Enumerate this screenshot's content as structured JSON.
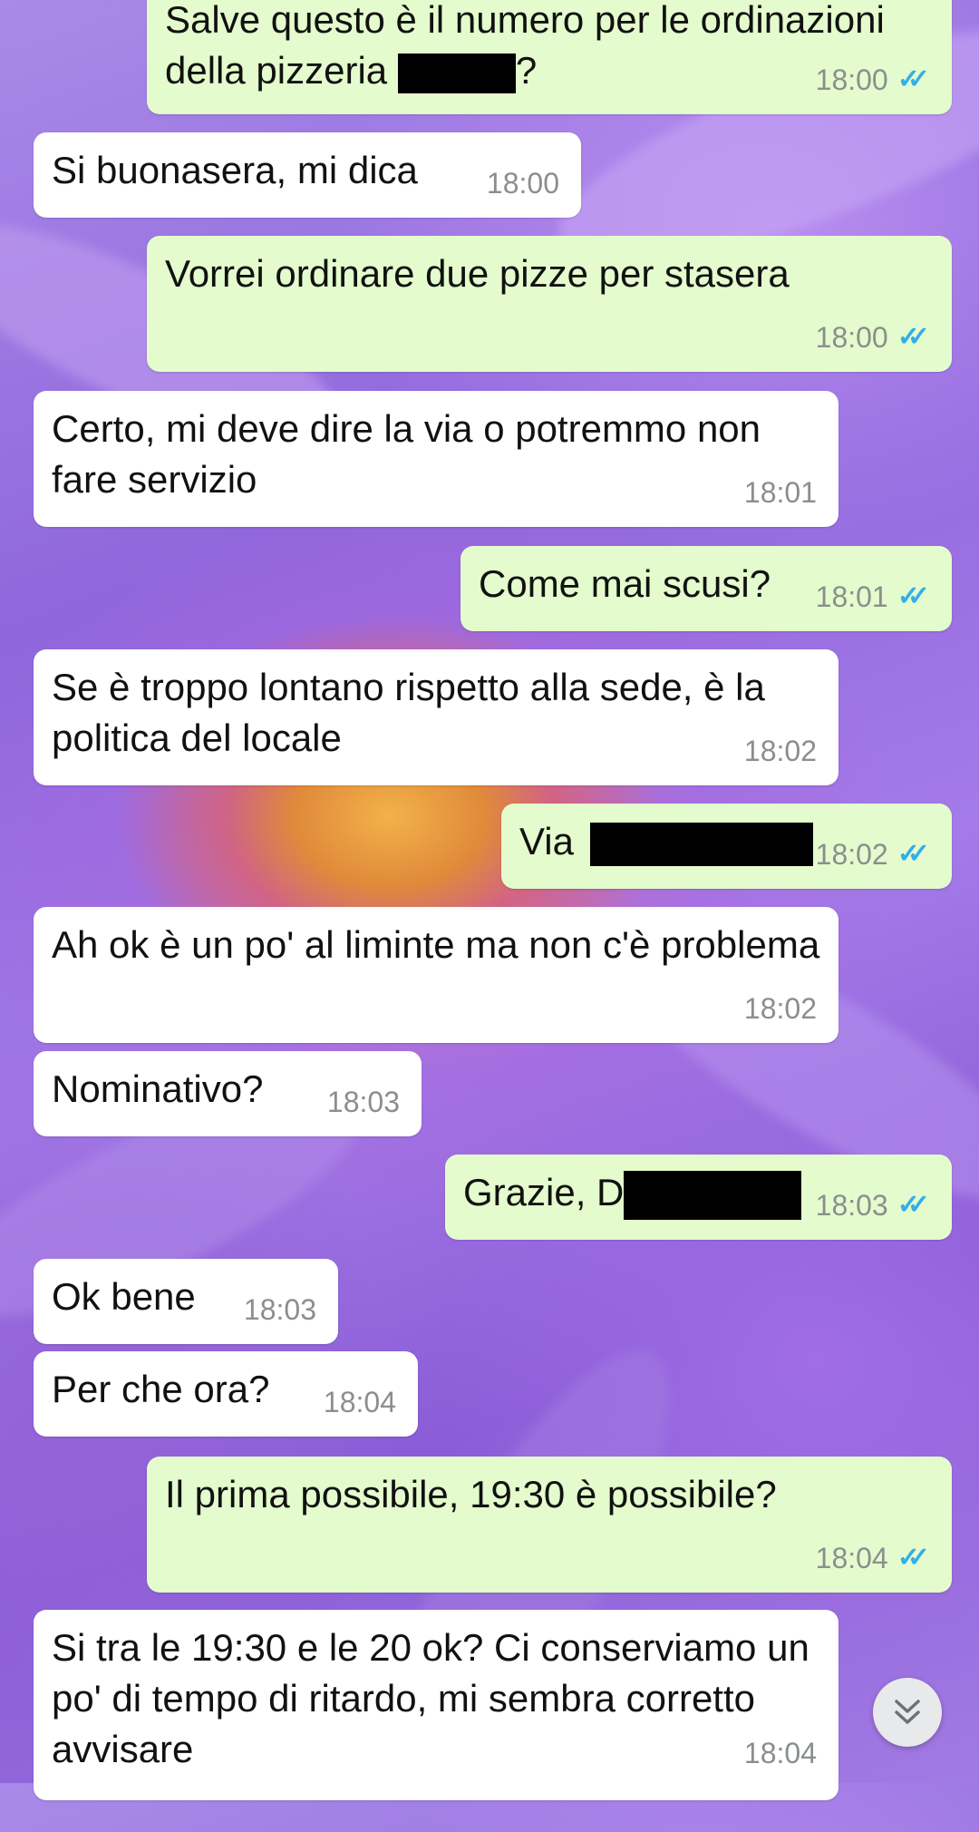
{
  "messages": [
    {
      "text_before": "Salve questo è il numero per le ordinazioni della pizzeria",
      "text_after": "?",
      "time": "18:00"
    },
    {
      "text": "Si buonasera, mi dica",
      "time": "18:00"
    },
    {
      "text": "Vorrei ordinare due pizze per stasera",
      "time": "18:00"
    },
    {
      "text": "Certo, mi deve dire la via o potremmo non fare servizio",
      "time": "18:01"
    },
    {
      "text": "Come mai scusi?",
      "time": "18:01"
    },
    {
      "text": "Se è troppo lontano rispetto alla sede, è la politica del locale",
      "time": "18:02"
    },
    {
      "text": "Via",
      "time": "18:02"
    },
    {
      "text": "Ah ok è un po' al liminte ma non c'è problema",
      "time": "18:02"
    },
    {
      "text": "Nominativo?",
      "time": "18:03"
    },
    {
      "text": "Grazie, D",
      "time": "18:03"
    },
    {
      "text": "Ok bene",
      "time": "18:03"
    },
    {
      "text": "Per che ora?",
      "time": "18:04"
    },
    {
      "text": "Il prima possibile, 19:30 è possibile?",
      "time": "18:04"
    },
    {
      "text": "Si tra le 19:30 e le 20 ok? Ci conserviamo un po' di tempo di ritardo, mi sembra corretto avvisare",
      "time": "18:04"
    }
  ],
  "icons": {
    "read_receipt": "double-check-icon",
    "scroll_down": "chevron-down-double-icon"
  },
  "colors": {
    "incoming": "#ffffff",
    "outgoing": "#e4fccd",
    "ticks": "#34aee8",
    "time": "#8a8f8c"
  }
}
